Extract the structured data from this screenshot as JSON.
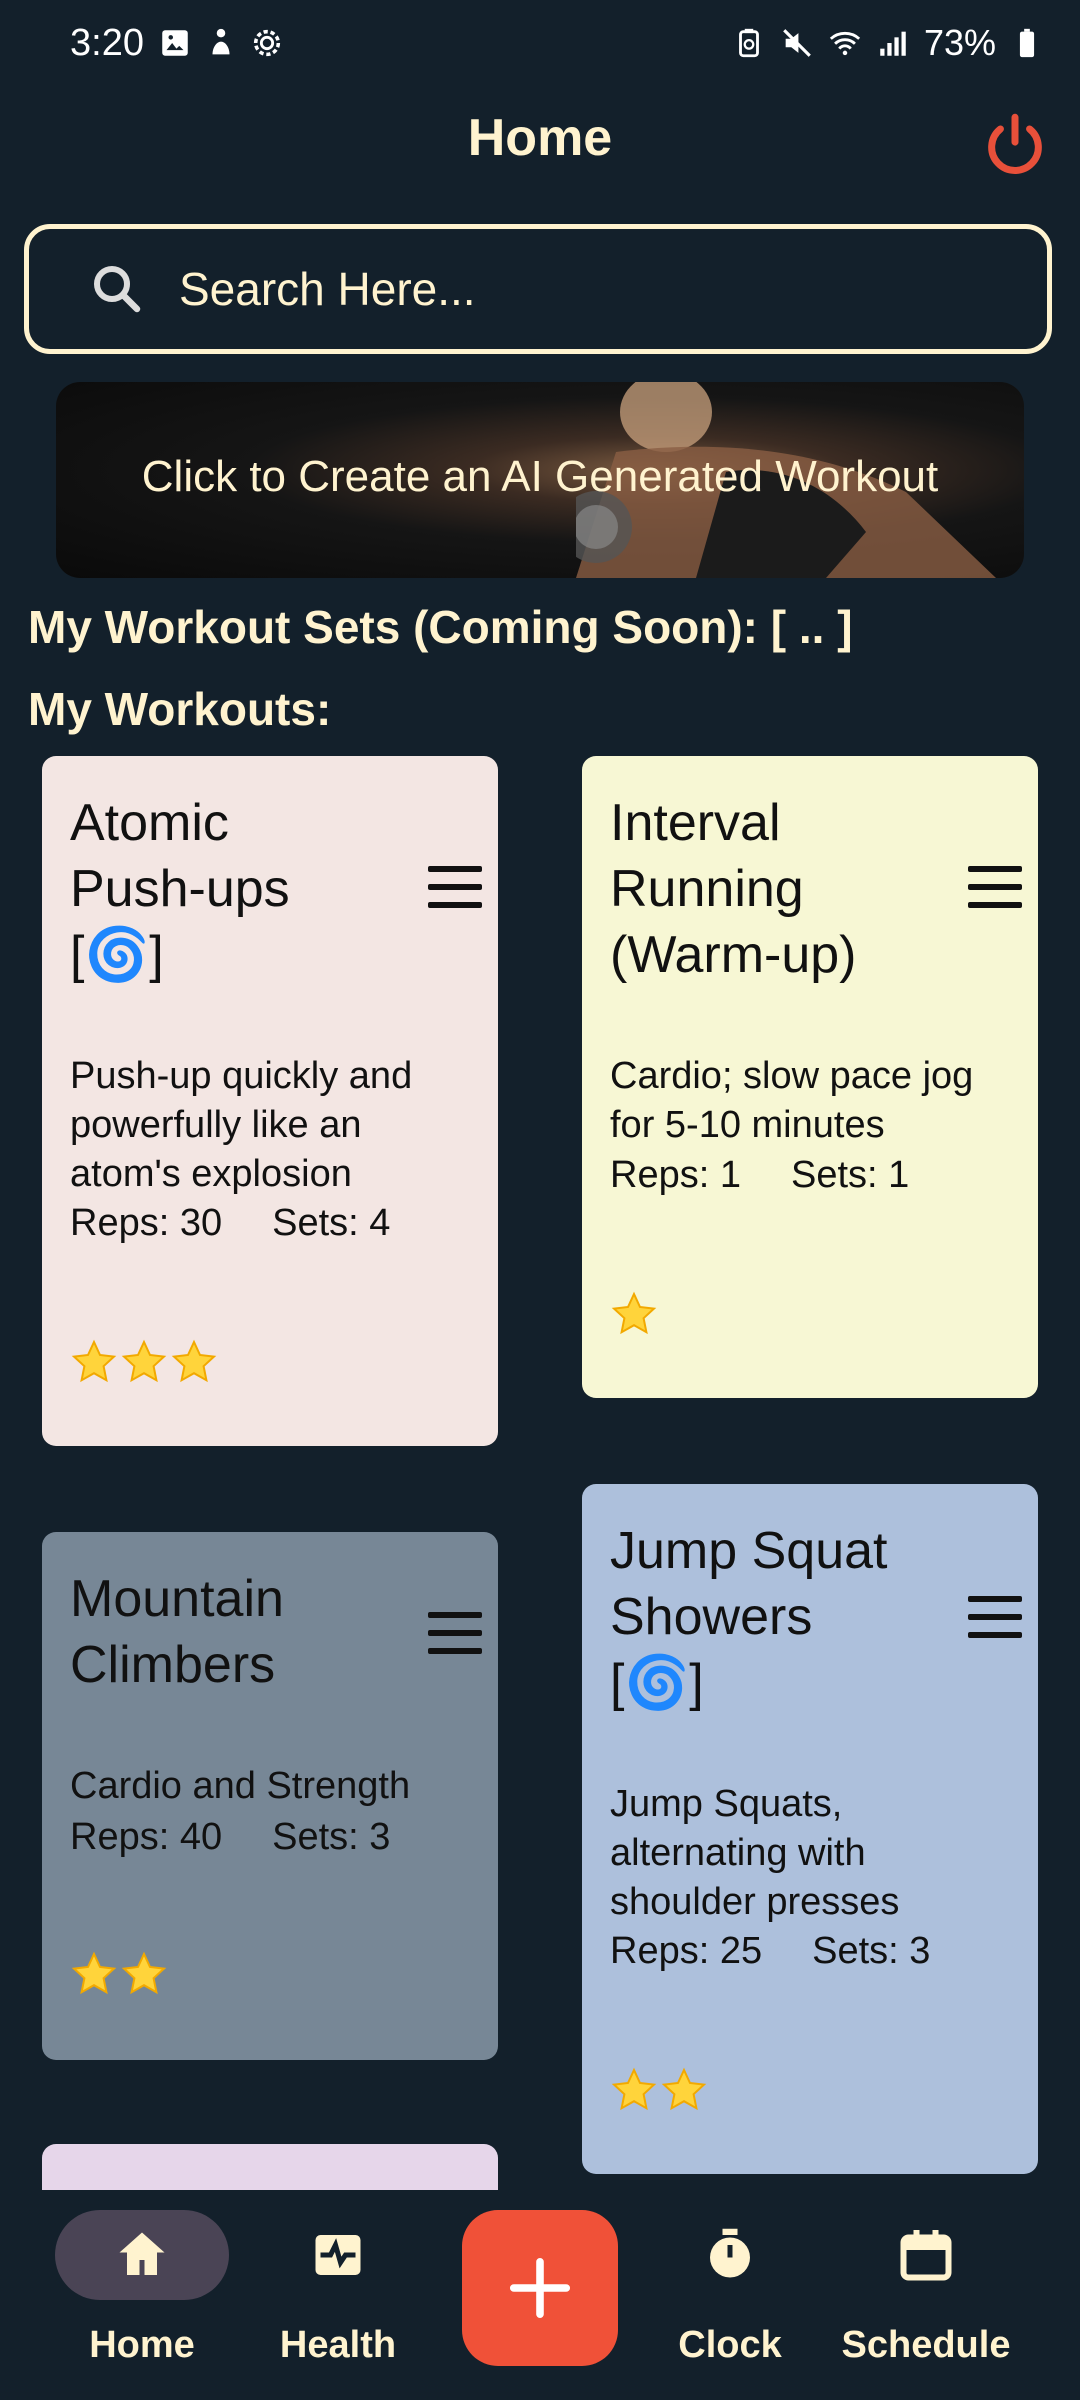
{
  "status": {
    "time": "3:20",
    "battery": "73%"
  },
  "header": {
    "title": "Home"
  },
  "search": {
    "placeholder": "Search Here..."
  },
  "banner": {
    "label": "Click to Create an AI Generated Workout"
  },
  "sections": {
    "workout_sets": "My Workout Sets (Coming Soon): [ .. ]",
    "workouts": "My Workouts:"
  },
  "cards": [
    {
      "title_line1": "Atomic",
      "title_line2": "Push-ups",
      "title_line3": "[🌀]",
      "description": "Push-up quickly and powerfully like an atom's explosion",
      "reps": "Reps: 30",
      "sets": "Sets: 4",
      "stars": 3,
      "color": "#f3e6e3"
    },
    {
      "title_line1": "Interval",
      "title_line2": "Running",
      "title_line3": "(Warm-up)",
      "description": "Cardio; slow pace jog for 5-10 minutes",
      "reps": "Reps: 1",
      "sets": "Sets: 1",
      "stars": 1,
      "color": "#f7f7d4"
    },
    {
      "title_line1": "Mountain",
      "title_line2": "Climbers",
      "title_line3": "",
      "description": "Cardio and Strength",
      "reps": "Reps: 40",
      "sets": "Sets: 3",
      "stars": 2,
      "color": "#778796"
    },
    {
      "title_line1": "Jump Squat",
      "title_line2": "Showers",
      "title_line3": "[🌀]",
      "description": "Jump Squats, alternating with shoulder presses",
      "reps": "Reps: 25",
      "sets": "Sets: 3",
      "stars": 2,
      "color": "#adc0dc"
    },
    {
      "color": "#e6d6ea"
    }
  ],
  "nav": {
    "home": "Home",
    "health": "Health",
    "clock": "Clock",
    "schedule": "Schedule"
  },
  "colors": {
    "background": "#13202b",
    "accent_text": "#fff3cf",
    "fab": "#f05138",
    "power": "#e8503a",
    "nav_active_pill": "#4a4455"
  }
}
